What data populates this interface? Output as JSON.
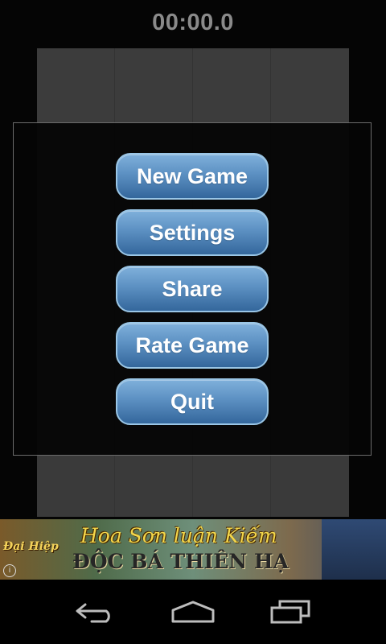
{
  "game": {
    "timer": "00:00.0",
    "board_columns": 4
  },
  "menu": {
    "items": [
      {
        "label": "New Game"
      },
      {
        "label": "Settings"
      },
      {
        "label": "Share"
      },
      {
        "label": "Rate Game"
      },
      {
        "label": "Quit"
      }
    ]
  },
  "ad": {
    "brand": "Đại Hiệp",
    "line1": "Hoa Sơn luận Kiếm",
    "line2": "ĐỘC BÁ THIÊN HẠ",
    "info_icon": "info-icon"
  },
  "navbar": {
    "back_icon": "back-icon",
    "home_icon": "home-icon",
    "recents_icon": "recents-icon"
  },
  "colors": {
    "button_top": "#7fb0db",
    "button_bottom": "#34679c",
    "button_border": "#9ac6e6",
    "timer": "#8a8a8a"
  }
}
